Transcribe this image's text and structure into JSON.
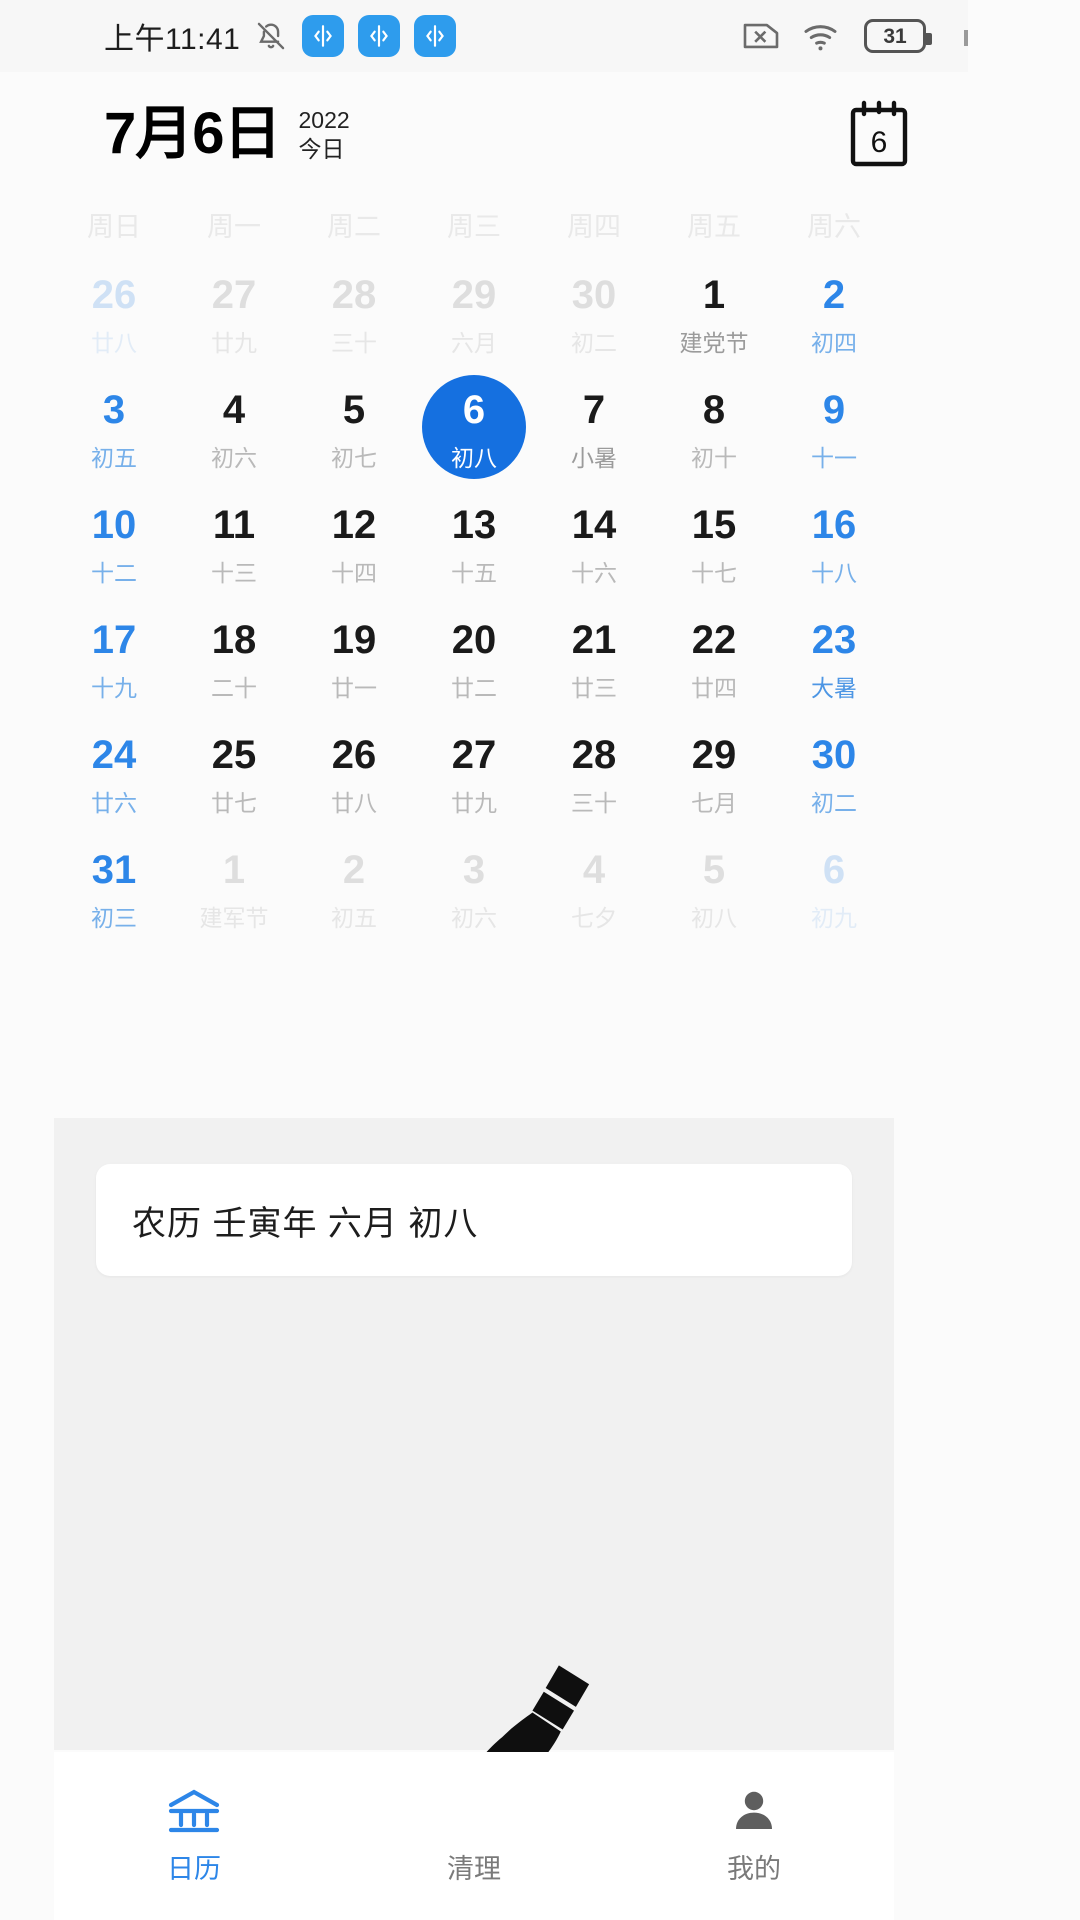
{
  "statusbar": {
    "time": "上午11:41",
    "battery_level": "31",
    "icons": [
      "bell-muted-icon",
      "app-chip-icon",
      "app-chip-icon",
      "app-chip-icon",
      "sim-card-off-icon",
      "wifi-icon",
      "battery-icon"
    ]
  },
  "header": {
    "date": "7月6日",
    "year": "2022",
    "today": "今日",
    "calendar_icon_day": "6"
  },
  "calendar": {
    "weekdays": [
      "周日",
      "周一",
      "周二",
      "周三",
      "周四",
      "周五",
      "周六"
    ],
    "days": [
      {
        "num": "26",
        "lunar": "廿八",
        "muted": true,
        "weekend": true
      },
      {
        "num": "27",
        "lunar": "廿九",
        "muted": true
      },
      {
        "num": "28",
        "lunar": "三十",
        "muted": true
      },
      {
        "num": "29",
        "lunar": "六月",
        "muted": true
      },
      {
        "num": "30",
        "lunar": "初二",
        "muted": true
      },
      {
        "num": "1",
        "lunar": "建党节",
        "term": true
      },
      {
        "num": "2",
        "lunar": "初四",
        "weekend": true
      },
      {
        "num": "3",
        "lunar": "初五",
        "weekend": true
      },
      {
        "num": "4",
        "lunar": "初六"
      },
      {
        "num": "5",
        "lunar": "初七"
      },
      {
        "num": "6",
        "lunar": "初八",
        "selected": true
      },
      {
        "num": "7",
        "lunar": "小暑",
        "term": true
      },
      {
        "num": "8",
        "lunar": "初十"
      },
      {
        "num": "9",
        "lunar": "十一",
        "weekend": true
      },
      {
        "num": "10",
        "lunar": "十二",
        "weekend": true
      },
      {
        "num": "11",
        "lunar": "十三"
      },
      {
        "num": "12",
        "lunar": "十四"
      },
      {
        "num": "13",
        "lunar": "十五"
      },
      {
        "num": "14",
        "lunar": "十六"
      },
      {
        "num": "15",
        "lunar": "十七"
      },
      {
        "num": "16",
        "lunar": "十八",
        "weekend": true
      },
      {
        "num": "17",
        "lunar": "十九",
        "weekend": true
      },
      {
        "num": "18",
        "lunar": "二十"
      },
      {
        "num": "19",
        "lunar": "廿一"
      },
      {
        "num": "20",
        "lunar": "廿二"
      },
      {
        "num": "21",
        "lunar": "廿三"
      },
      {
        "num": "22",
        "lunar": "廿四"
      },
      {
        "num": "23",
        "lunar": "大暑",
        "weekend": true,
        "term": true
      },
      {
        "num": "24",
        "lunar": "廿六",
        "weekend": true
      },
      {
        "num": "25",
        "lunar": "廿七"
      },
      {
        "num": "26",
        "lunar": "廿八"
      },
      {
        "num": "27",
        "lunar": "廿九"
      },
      {
        "num": "28",
        "lunar": "三十"
      },
      {
        "num": "29",
        "lunar": "七月"
      },
      {
        "num": "30",
        "lunar": "初二",
        "weekend": true
      },
      {
        "num": "31",
        "lunar": "初三",
        "weekend": true
      },
      {
        "num": "1",
        "lunar": "建军节",
        "muted": true
      },
      {
        "num": "2",
        "lunar": "初五",
        "muted": true
      },
      {
        "num": "3",
        "lunar": "初六",
        "muted": true
      },
      {
        "num": "4",
        "lunar": "七夕",
        "muted": true
      },
      {
        "num": "5",
        "lunar": "初八",
        "muted": true
      },
      {
        "num": "6",
        "lunar": "初九",
        "muted": true,
        "weekend": true
      }
    ]
  },
  "lunar_card": {
    "text": "农历 壬寅年 六月 初八"
  },
  "bottom_nav": {
    "items": [
      {
        "label": "日历",
        "icon": "calendar-bank-icon",
        "active": true
      },
      {
        "label": "清理",
        "icon": "broom-icon",
        "active": false
      },
      {
        "label": "我的",
        "icon": "person-icon",
        "active": false
      }
    ]
  },
  "colors": {
    "accent": "#2d86e8",
    "selected": "#1570e0",
    "muted": "#dedede",
    "chip": "#2e9ced"
  }
}
